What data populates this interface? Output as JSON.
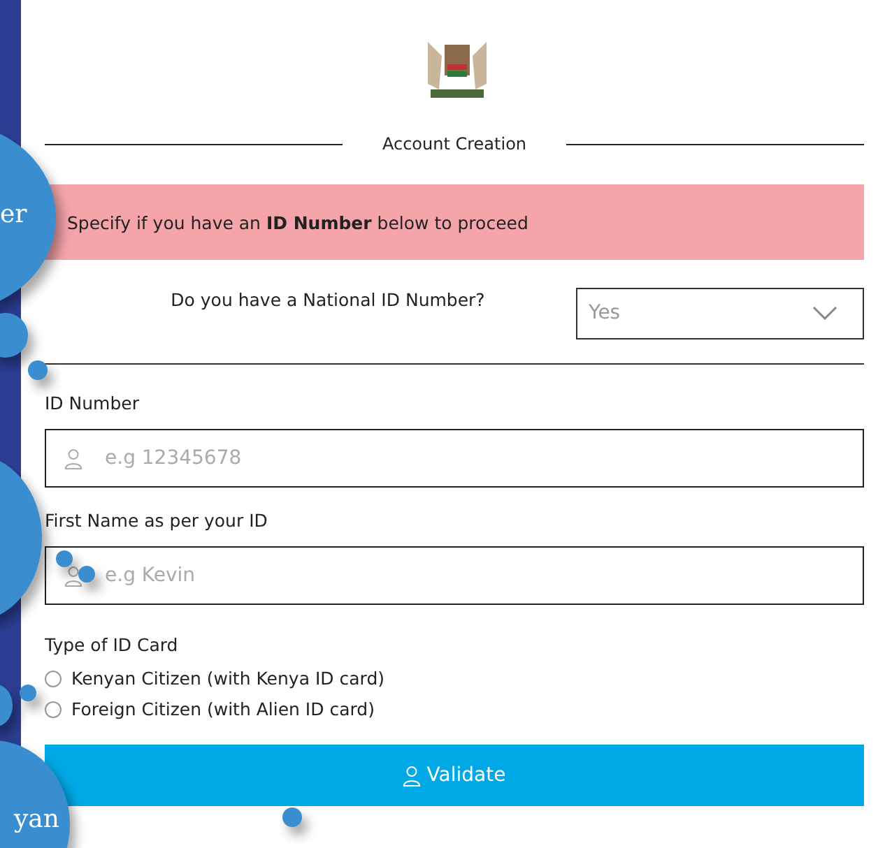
{
  "header": {
    "title": "Account Creation"
  },
  "alert": {
    "text": "Specify if you have an **ID Number** below to proceed"
  },
  "national_id_question": {
    "label": "Do you have a National ID Number?",
    "value": "Yes"
  },
  "fields": [
    {
      "label": "ID Number",
      "placeholder": "e.g 12345678"
    },
    {
      "label": "First Name as per your ID",
      "placeholder": "e.g Kevin"
    }
  ],
  "id_card_type": {
    "label": "Type of ID Card",
    "options": [
      {
        "label": "Kenyan Citizen (with Kenya ID card)",
        "selected": false
      },
      {
        "label": "Foreign Citizen (with Alien ID card)",
        "selected": false
      }
    ]
  },
  "validate_button": {
    "label": "Validate"
  },
  "bubbles": [
    {
      "text": "er"
    },
    {
      "text": "yan"
    }
  ]
}
